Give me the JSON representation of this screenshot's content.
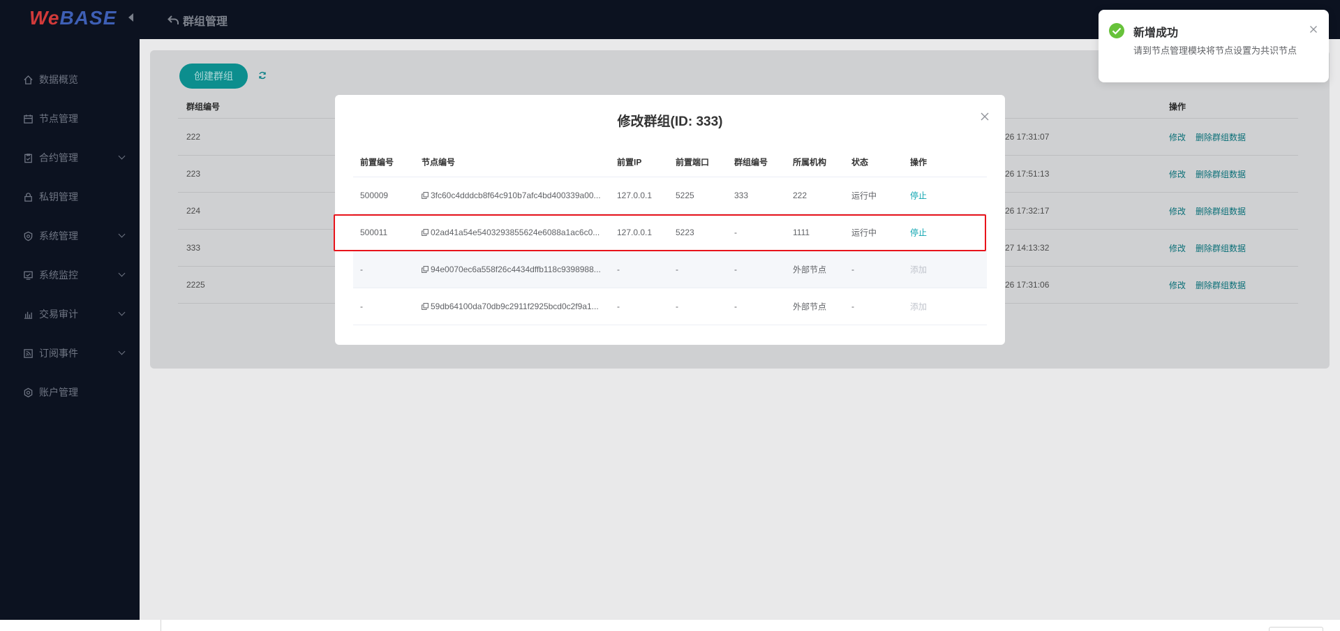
{
  "logo": {
    "part1": "We",
    "part2": "BASE"
  },
  "header": {
    "title": "群组管理"
  },
  "sidebar": {
    "items": [
      {
        "label": "数据概览",
        "icon": "home-icon",
        "has_children": false
      },
      {
        "label": "节点管理",
        "icon": "calendar-icon",
        "has_children": false
      },
      {
        "label": "合约管理",
        "icon": "clipboard-icon",
        "has_children": true
      },
      {
        "label": "私钥管理",
        "icon": "lock-icon",
        "has_children": false
      },
      {
        "label": "系统管理",
        "icon": "shield-icon",
        "has_children": true
      },
      {
        "label": "系统监控",
        "icon": "monitor-icon",
        "has_children": true
      },
      {
        "label": "交易审计",
        "icon": "bar-chart-icon",
        "has_children": true
      },
      {
        "label": "订阅事件",
        "icon": "rss-icon",
        "has_children": true
      },
      {
        "label": "账户管理",
        "icon": "gear-icon",
        "has_children": false
      }
    ]
  },
  "main": {
    "create_button": "创建群组",
    "table": {
      "col_group_id": "群组编号",
      "col_ops": "操作",
      "rows": [
        {
          "id": "222",
          "time": "26 17:31:07"
        },
        {
          "id": "223",
          "time": "26 17:51:13"
        },
        {
          "id": "224",
          "time": "26 17:32:17"
        },
        {
          "id": "333",
          "time": "27 14:13:32"
        },
        {
          "id": "2225",
          "time": "26 17:31:06"
        }
      ],
      "op_edit": "修改",
      "op_delete": "删除群组数据"
    }
  },
  "modal": {
    "title": "修改群组(ID: 333)",
    "headers": [
      "前置编号",
      "节点编号",
      "前置IP",
      "前置端口",
      "群组编号",
      "所属机构",
      "状态",
      "操作"
    ],
    "rows": [
      {
        "front_id": "500009",
        "node_id": "3fc60c4dddcb8f64c910b7afc4bd400339a00...",
        "ip": "127.0.0.1",
        "port": "5225",
        "group": "333",
        "org": "222",
        "status": "运行中",
        "action": "停止",
        "action_enabled": true
      },
      {
        "front_id": "500011",
        "node_id": "02ad41a54e5403293855624e6088a1ac6c0...",
        "ip": "127.0.0.1",
        "port": "5223",
        "group": "-",
        "org": "1111",
        "status": "运行中",
        "action": "停止",
        "action_enabled": true
      },
      {
        "front_id": "-",
        "node_id": "94e0070ec6a558f26c4434dffb118c9398988...",
        "ip": "-",
        "port": "-",
        "group": "-",
        "org": "外部节点",
        "status": "-",
        "action": "添加",
        "action_enabled": false
      },
      {
        "front_id": "-",
        "node_id": "59db64100da70db9c2911f2925bcd0c2f9a1...",
        "ip": "-",
        "port": "-",
        "group": "-",
        "org": "外部节点",
        "status": "-",
        "action": "添加",
        "action_enabled": false
      }
    ]
  },
  "notification": {
    "title": "新增成功",
    "message": "请到节点管理模块将节点设置为共识节点",
    "colors": {
      "success": "#67c23a"
    }
  },
  "colors": {
    "accent": "#0ba4b0",
    "highlight_box": "#e8141b",
    "sidebar_bg": "#0c1220"
  }
}
